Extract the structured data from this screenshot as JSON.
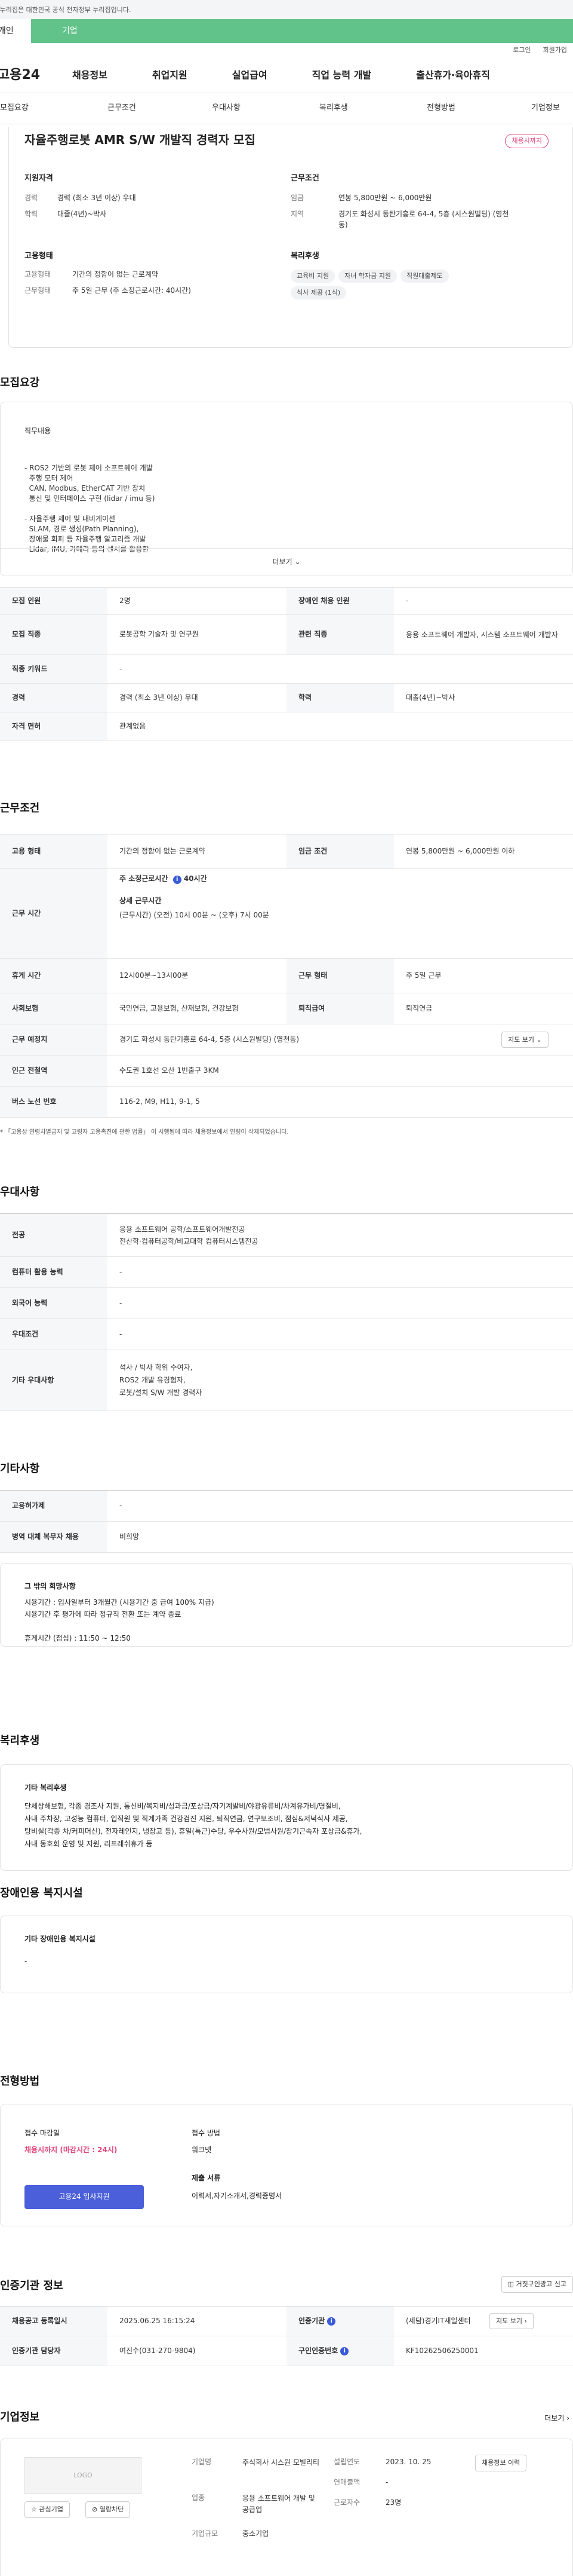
{
  "notice": "이 누리집은 대한민국 공식 전자정부 누리집입니다.",
  "categories": [
    "개인",
    "기업"
  ],
  "util": [
    "로그인",
    "회원가입"
  ],
  "gnb": {
    "logo": "고용24",
    "items": [
      "채용정보",
      "취업지원",
      "실업급여",
      "직업 능력 개발",
      "출산휴가·육아휴직"
    ]
  },
  "tabs": [
    "모집요강",
    "근무조건",
    "우대사항",
    "복리후생",
    "전형방법",
    "기업정보"
  ],
  "job": {
    "title": "자율주행로봇 AMR S/W 개발직 경력자 모집",
    "badge": "채용시까지",
    "qual_title": "지원자격",
    "career_l": "경력",
    "career_v": "경력 (최소 3년 이상) 우대",
    "edu_l": "학력",
    "edu_v": "대졸(4년)~박사",
    "emp_title": "고용형태",
    "emp_l": "고용형태",
    "emp_v": "기간의 정함이 없는 근로계약",
    "work_l": "근무형태",
    "work_v": "주 5일 근무 (주 소정근로시간: 40시간)",
    "cond_title": "근무조건",
    "wage_l": "임금",
    "wage_v": "연봉 5,800만원 ~ 6,000만원",
    "loc_l": "지역",
    "loc_v": "경기도 화성시 동탄기흥로 64-4, 5층 (시스원빌딩) (영천동)",
    "welfare_title": "복리후생",
    "welfare": [
      "교육비 지원",
      "자녀 학자금 지원",
      "직원대출제도",
      "식사 제공 (1식)"
    ]
  },
  "recruit": {
    "title": "모집요강",
    "duty_title": "직무내용",
    "duty": [
      "- ROS2 기반의 로봇 제어 소프트웨어 개발",
      "  주행 모터 제어",
      "  CAN, Modbus, EtherCAT 기반 장치",
      "  통신 및 인터페이스 구현 (lidar / imu 등)",
      "",
      "- 자율주행 제어 및 내비게이션",
      "  SLAM, 경로 생성(Path Planning),",
      "  장애물 회피 등 자율주행 알고리즘 개발",
      "  Lidar, IMU, 카메라 등의 센서를 활용한"
    ],
    "more": "더보기",
    "rows": [
      [
        "모집 인원",
        "2명",
        "장애인 채용 인원",
        "-"
      ],
      [
        "모집 직종",
        "로봇공학 기술자 및 연구원",
        "관련 직종",
        "응용 소프트웨어 개발자, 시스템 소프트웨어 개발자"
      ],
      [
        "직종 키워드",
        "-"
      ],
      [
        "경력",
        "경력 (최소 3년 이상) 우대",
        "학력",
        "대졸(4년)~박사"
      ],
      [
        "자격 면허",
        "관계없음"
      ]
    ]
  },
  "work": {
    "title": "근무조건",
    "r1": [
      "고용 형태",
      "기간의 정함이 없는 근로계약",
      "임금 조건",
      "연봉 5,800만원 ~ 6,000만원 이하"
    ],
    "time_l": "근무 시간",
    "time_week": "주 소정근로시간",
    "time_hours": "40시간",
    "time_detail_t": "상세 근무시간",
    "time_detail": "(근무시간) (오전) 10시 00분 ~ (오후) 7시 00분",
    "rows": [
      [
        "휴게 시간",
        "12시00분~13시00분",
        "근무 형태",
        "주 5일 근무"
      ],
      [
        "사회보험",
        "국민연금, 고용보험, 산재보험, 건강보험",
        "퇴직급여",
        "퇴직연금"
      ]
    ],
    "place_l": "근무 예정지",
    "place_v": "경기도 화성시 동탄기흥로 64-4, 5층 (시스원빌딩) (영천동)",
    "map_btn": "지도 보기",
    "rows2": [
      [
        "인근 전철역",
        "수도권 1호선 오산 1번출구 3KM"
      ],
      [
        "버스 노선 번호",
        "116-2, M9, H11, 9-1, 5"
      ]
    ],
    "note": "* 「고용상 연령차별금지 및 고령자 고용촉진에 관한 법률」 이 시행됨에 따라 채용정보에서 연령이 삭제되었습니다."
  },
  "prefer": {
    "title": "우대사항",
    "rows": [
      [
        "전공",
        [
          "응용 소프트웨어 공학/소프트웨어개발전공",
          "전산학·컴퓨터공학/비교대학 컴퓨터시스템전공"
        ]
      ],
      [
        "컴퓨터 활용 능력",
        [
          "-"
        ]
      ],
      [
        "외국어 능력",
        [
          "-"
        ]
      ],
      [
        "우대조건",
        [
          "-"
        ]
      ],
      [
        "기타 우대사항",
        [
          "석사 / 박사 학위 수여자,",
          "ROS2 개발 유경험자,",
          "로봇/설치 S/W 개발 경력자"
        ]
      ]
    ]
  },
  "etc": {
    "title": "기타사항",
    "rows": [
      [
        "고용허가제",
        "-"
      ],
      [
        "병역 대체 복무자 채용",
        "비희망"
      ]
    ],
    "box_title": "그 밖의 희망사항",
    "box_lines": [
      "시용기간 : 입사일부터 3개월간 (시용기간 중 급여 100% 지급)",
      "시용기간 후 평가에 따라 정규직 전환 또는 계약 종료",
      "",
      "휴게시간 (점심) : 11:50 ~ 12:50"
    ]
  },
  "welfare": {
    "title": "복리후생",
    "box_title": "기타 복리후생",
    "lines": [
      "단체상해보험, 각종 경조사 지원, 통신비/복지비/성과금/포상금/자기계발비/야광유류비/차계유가비/명절비,",
      "사내 주차장, 고성능 컴퓨터, 입직원 및 직계가족 건강검진 지원, 퇴직연금, 연구보조비, 점심&저녁식사 제공,",
      "탕비실(각종 차/커피머신), 전자레인지, 냉장고 등), 휴일(특근)수당, 우수사원/모범사원/장기근속자 포상금&휴가,",
      "사내 동호회 운영 및 지원, 리프레쉬휴가 등"
    ]
  },
  "disabled": {
    "title": "장애인용 복지시설",
    "box_title": "기타 장애인용 복지시설",
    "value": "-"
  },
  "process": {
    "title": "전형방법",
    "deadline_l": "접수 마감일",
    "deadline_v": "채용시까지 (마감시간 : 24시)",
    "apply_btn": "고용24 입사지원",
    "method_l": "접수 방법",
    "method_v": "워크넷",
    "docs_l": "제출 서류",
    "docs_v": "이력서,자기소개서,경력증명서"
  },
  "cert": {
    "title": "인증기관 정보",
    "report_btn": "거짓구인광고 신고",
    "rows": [
      [
        "채용공고 등록일시",
        "2025.06.25 16:15:24",
        "인증기관",
        "(세담)경기IT새일센터"
      ],
      [
        "인증기관 담당자",
        "여진수(031-270-9804)",
        "구인인증번호",
        "KF10262506250001"
      ]
    ],
    "map_btn": "지도 보기"
  },
  "company": {
    "title": "기업정보",
    "more": "더보기",
    "logo": "LOGO",
    "fav": "관심기업",
    "block": "열람차단",
    "name_l": "기업명",
    "name_v": "주식회사 시스원 모빌리티",
    "est_l": "설립연도",
    "est_v": "2023. 10. 25",
    "info_btn": "채용정보 이력",
    "ind_l": "업종",
    "ind_v": "응용 소프트웨어 개발 및 공급업",
    "sales_l": "연매출액",
    "sales_v": "-",
    "emp_l": "근로자수",
    "emp_v": "23명",
    "size_l": "기업규모",
    "size_v": "중소기업"
  }
}
